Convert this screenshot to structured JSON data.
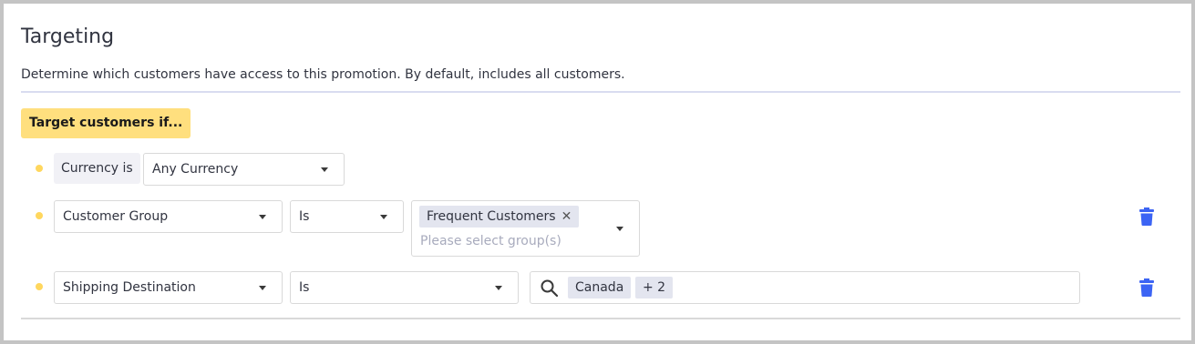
{
  "section": {
    "title": "Targeting",
    "description": "Determine which customers have access to this promotion. By default, includes all customers.",
    "badge": "Target customers if..."
  },
  "rules": [
    {
      "label": "Currency is",
      "value": "Any Currency"
    },
    {
      "field": "Customer Group",
      "operator": "Is",
      "chips": [
        "Frequent Customers"
      ],
      "chip_remove_icon": "close-icon",
      "placeholder": "Please select group(s)",
      "delete_icon": "trash-icon"
    },
    {
      "field": "Shipping Destination",
      "operator": "Is",
      "search_icon": "search-icon",
      "chips": [
        "Canada"
      ],
      "more_chip": "+ 2",
      "delete_icon": "trash-icon"
    }
  ],
  "colors": {
    "badge": "#ffdf7e",
    "bullet": "#ffd75e",
    "trash": "#3c64f4",
    "chip": "#e3e5ef",
    "placeholder": "#a8abbd"
  }
}
